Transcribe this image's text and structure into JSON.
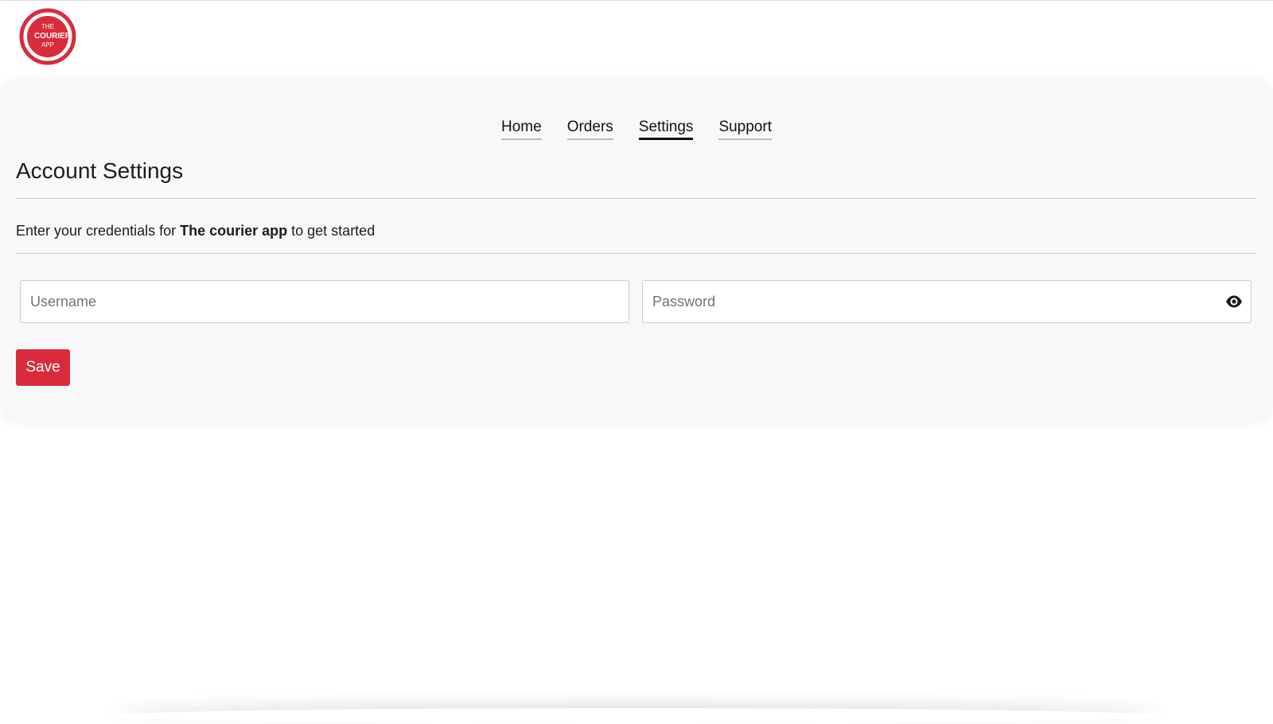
{
  "logo": {
    "line1": "THE",
    "line2": "COURIER",
    "line3": "APP",
    "color": "#d82c3c"
  },
  "nav": {
    "items": [
      {
        "label": "Home"
      },
      {
        "label": "Orders"
      },
      {
        "label": "Settings",
        "active": true
      },
      {
        "label": "Support"
      }
    ]
  },
  "page": {
    "title": "Account Settings",
    "intro_prefix": "Enter your credentials for ",
    "intro_app": "The courier app",
    "intro_suffix": " to get started"
  },
  "form": {
    "username": {
      "placeholder": "Username",
      "value": ""
    },
    "password": {
      "placeholder": "Password",
      "value": "",
      "toggle_icon": "eye-icon"
    },
    "save_label": "Save"
  },
  "colors": {
    "accent": "#d82c3c",
    "panel_bg": "#f7f8f9"
  }
}
